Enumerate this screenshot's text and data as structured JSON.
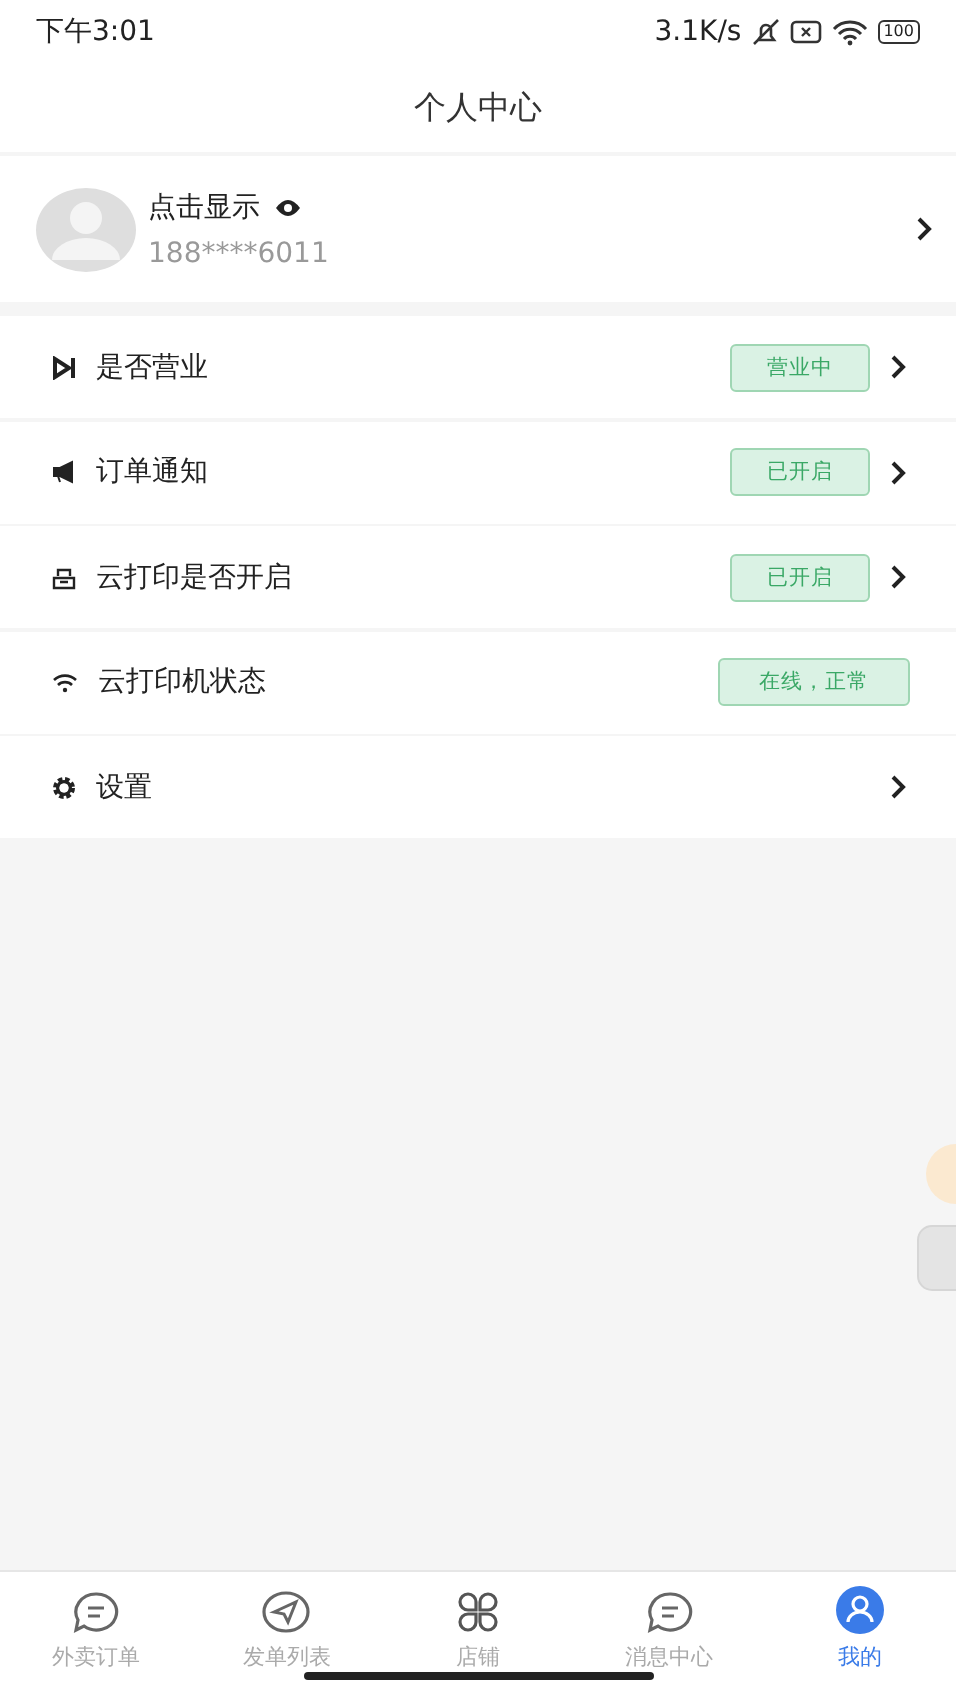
{
  "status_bar": {
    "time": "下午3:01",
    "speed": "3.1K/s",
    "battery": "100"
  },
  "title": "个人中心",
  "profile": {
    "name": "点击显示",
    "phone": "188****6011"
  },
  "menu": [
    {
      "kind": "business",
      "label": "是否营业",
      "badge": "营业中",
      "chevron": true
    },
    {
      "kind": "notify",
      "label": "订单通知",
      "badge": "已开启",
      "chevron": true
    },
    {
      "kind": "print",
      "label": "云打印是否开启",
      "badge": "已开启",
      "chevron": true
    },
    {
      "kind": "wifi",
      "label": "云打印机状态",
      "badge": "在线，正常",
      "chevron": false
    },
    {
      "kind": "settings",
      "label": "设置",
      "chevron": true
    }
  ],
  "tab_bar": [
    {
      "kind": "chat",
      "label": "外卖订单",
      "selected": false
    },
    {
      "kind": "send",
      "label": "发单列表",
      "selected": false
    },
    {
      "kind": "grid",
      "label": "店铺",
      "selected": false
    },
    {
      "kind": "message",
      "label": "消息中心",
      "selected": false
    },
    {
      "kind": "person",
      "label": "我的",
      "selected": true
    }
  ]
}
